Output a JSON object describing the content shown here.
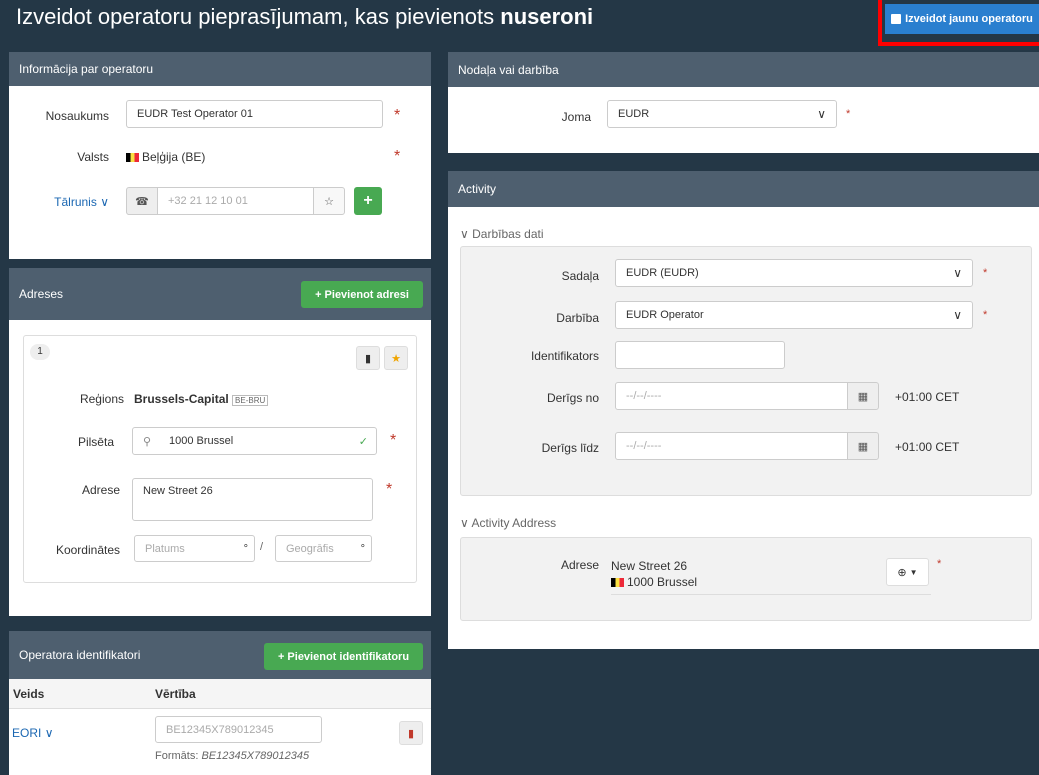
{
  "header": {
    "title_prefix": "Izveidot operatoru pieprasījumam, kas pievienots",
    "title_bold": "nuseroni",
    "create_button_label": "Izveidot jaunu operatoru"
  },
  "operator_info": {
    "panel_title": "Informācija par operatoru",
    "name_label": "Nosaukums",
    "name_value": "EUDR Test Operator 01",
    "country_label": "Valsts",
    "country_value": "Beļģija (BE)",
    "phone_label": "Tālrunis",
    "phone_placeholder": "+32 21 12 10 01",
    "required_mark": "*"
  },
  "addresses": {
    "panel_title": "Adreses",
    "add_button_label": "Pievienot adresi",
    "index": "1",
    "region_label": "Reģions",
    "region_value": "Brussels-Capital",
    "region_code": "BE-BRU",
    "city_label": "Pilsēta",
    "city_value": "1000 Brussel",
    "address_label": "Adrese",
    "address_value": "New Street 26",
    "coords_label": "Koordinātes",
    "lat_placeholder": "Platums",
    "lon_placeholder": "Geogrāfis",
    "degree": "°",
    "slash": "/"
  },
  "identifiers": {
    "panel_title": "Operatora identifikatori",
    "add_button_label": "Pievienot identifikatoru",
    "col_type": "Veids",
    "col_value": "Vērtība",
    "type_value": "EORI",
    "value_placeholder": "BE12345X789012345",
    "format_label": "Formāts:",
    "format_value": "BE12345X789012345"
  },
  "division": {
    "panel_title": "Nodaļa vai darbība",
    "domain_label": "Joma",
    "domain_value": "EUDR"
  },
  "activity": {
    "panel_title": "Activity",
    "data_section": "Darbības dati",
    "section_label": "Sadaļa",
    "section_value": "EUDR (EUDR)",
    "action_label": "Darbība",
    "action_value": "EUDR Operator",
    "identifier_label": "Identifikators",
    "valid_from_label": "Derīgs no",
    "valid_to_label": "Derīgs līdz",
    "date_placeholder": "--/--/----",
    "timezone": "+01:00 CET",
    "address_section": "Activity Address",
    "address_label": "Adrese",
    "address_line1": "New Street 26",
    "address_line2": "1000 Brussel"
  }
}
